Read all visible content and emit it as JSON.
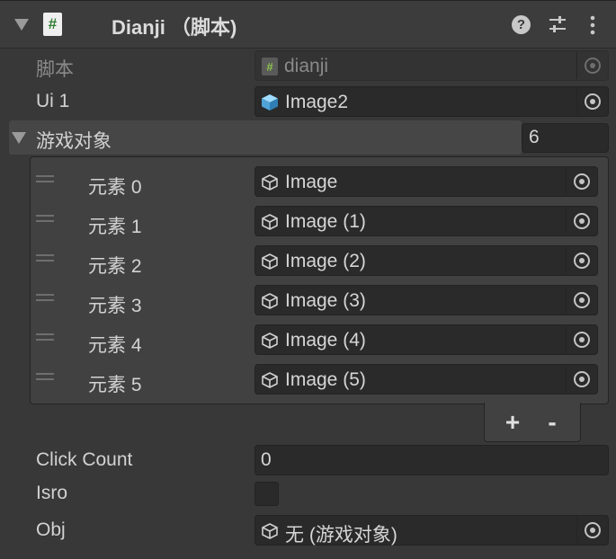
{
  "component": {
    "title": "Dianji （脚本)",
    "script_icon_glyph": "#",
    "help_glyph": "?"
  },
  "fields": {
    "script": {
      "label": "脚本",
      "value": "dianji"
    },
    "ui1": {
      "label": "Ui 1",
      "value": "Image2"
    }
  },
  "array": {
    "label": "游戏对象",
    "size": "6",
    "items": [
      {
        "label": "元素 0",
        "value": "Image"
      },
      {
        "label": "元素 1",
        "value": "Image (1)"
      },
      {
        "label": "元素 2",
        "value": "Image (2)"
      },
      {
        "label": "元素 3",
        "value": "Image (3)"
      },
      {
        "label": "元素 4",
        "value": "Image (4)"
      },
      {
        "label": "元素 5",
        "value": "Image (5)"
      }
    ],
    "add_label": "+",
    "remove_label": "-"
  },
  "click_count": {
    "label": "Click Count",
    "value": "0"
  },
  "isro": {
    "label": "Isro",
    "checked": false
  },
  "obj": {
    "label": "Obj",
    "value": "无 (游戏对象)"
  }
}
